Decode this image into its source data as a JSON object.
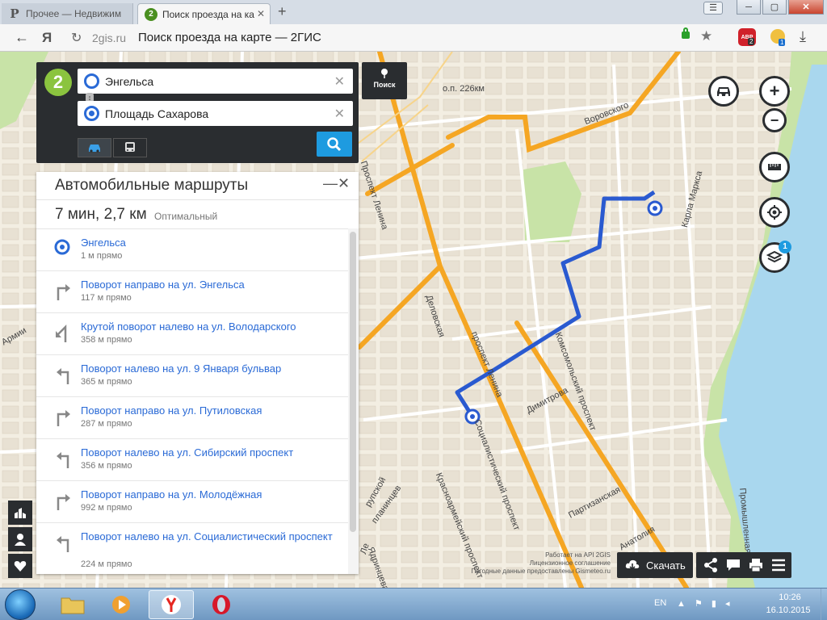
{
  "browser": {
    "tabs": [
      {
        "label": "Прочее — Недвижим",
        "favicon": "Р"
      },
      {
        "label": "Поиск проезда на ка",
        "favicon": "2"
      }
    ],
    "window_controls": {
      "minimize": "─",
      "maximize": "▢",
      "close": "✕"
    },
    "menu_glyph": "☰",
    "yandex_logo": "Я",
    "url_domain": "2gis.ru",
    "url_title": "Поиск проезда на карте — 2ГИС",
    "abp_label": "ABP",
    "abp_badge": "2",
    "ext_badge": "1"
  },
  "search": {
    "logo": "2",
    "from": "Энгельса",
    "to": "Площадь Сахарова",
    "poisk_label": "Поиск"
  },
  "route": {
    "title": "Автомобильные маршруты",
    "summary": "7 мин, 2,7 км",
    "option": "Оптимальный",
    "steps": [
      {
        "title": "Энгельса",
        "sub": "1 м прямо",
        "icon": "start-icon"
      },
      {
        "title": "Поворот направо на ул. Энгельса",
        "sub": "117 м прямо",
        "icon": "turn-right-icon"
      },
      {
        "title": "Крутой поворот налево на ул. Володарского",
        "sub": "358 м прямо",
        "icon": "sharp-left-icon"
      },
      {
        "title": "Поворот налево на ул. 9 Января бульвар",
        "sub": "365 м прямо",
        "icon": "turn-left-icon"
      },
      {
        "title": "Поворот направо на ул. Путиловская",
        "sub": "287 м прямо",
        "icon": "turn-right-icon"
      },
      {
        "title": "Поворот налево на ул. Сибирский проспект",
        "sub": "356 м прямо",
        "icon": "turn-left-icon"
      },
      {
        "title": "Поворот направо на ул. Молодёжная",
        "sub": "992 м прямо",
        "icon": "turn-right-icon"
      },
      {
        "title": "Поворот налево на ул. Социалистический проспект",
        "sub": "224 м прямо",
        "icon": "turn-left-icon"
      }
    ]
  },
  "map": {
    "streets": {
      "voroshilovskogo": "Воровского",
      "karla_marksa": "Карла Маркса",
      "station": "о.п. 226км",
      "prospekt_lenina_top": "Проспект Ленина",
      "prospekt_lenina": "проспект Ленина",
      "delovskaya": "Деловская",
      "komsomolsky": "Комсомольский проспект",
      "dimitrova": "Димитрова",
      "socialistichesky": "Социалистический проспект",
      "krasnoarmeysky": "Красноармейский проспект",
      "partizanskaya": "Партизанская",
      "anatolia": "Анатолия",
      "promyshlennaya": "Промышленная",
      "armii": "Армии",
      "rupskoy": "рупской",
      "planintsev": "планинцев",
      "yadrintseva": "Ядринцева",
      "lenina_short": "Ле"
    },
    "colors": {
      "route": "#2a5ad0",
      "main_road": "#f5a623",
      "river": "#a9d7ee",
      "park": "#c8e3a7"
    }
  },
  "credits": {
    "line1": "Работает на API 2GIS",
    "line2": "Лицензионное соглашение",
    "line3": "Погодные данные предоставлены Gismeteo.ru"
  },
  "toolbar": {
    "download_label": "Скачать"
  },
  "controls": {
    "layers_badge": "1",
    "zoom_in": "+",
    "zoom_out": "−"
  },
  "taskbar": {
    "lang": "EN",
    "time": "10:26",
    "date": "16.10.2015"
  }
}
